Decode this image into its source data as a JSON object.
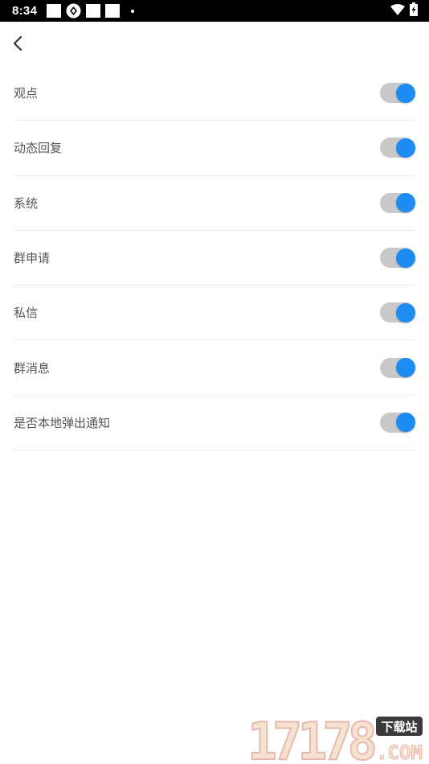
{
  "status_bar": {
    "time": "8:34"
  },
  "header": {
    "back_icon": "chevron-left-icon"
  },
  "settings": [
    {
      "label": "观点",
      "enabled": true
    },
    {
      "label": "动态回复",
      "enabled": true
    },
    {
      "label": "系统",
      "enabled": true
    },
    {
      "label": "群申请",
      "enabled": true
    },
    {
      "label": "私信",
      "enabled": true
    },
    {
      "label": "群消息",
      "enabled": true
    },
    {
      "label": "是否本地弹出通知",
      "enabled": true
    }
  ],
  "colors": {
    "toggle_on": "#1e8df3",
    "toggle_track": "#c9c9c9",
    "label_text": "#555555",
    "divider": "#ececec"
  },
  "watermark": {
    "number": "17178",
    "tag": "下载站",
    "domain": ".COM"
  }
}
